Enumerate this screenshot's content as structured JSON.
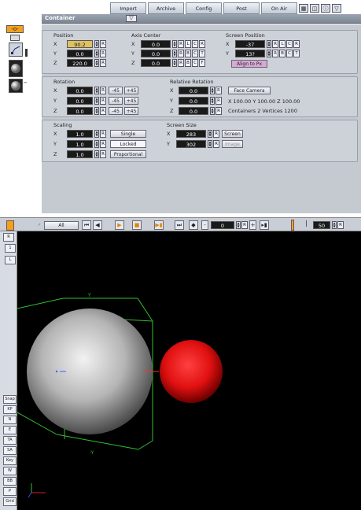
{
  "menu": {
    "items": [
      "Import",
      "Archive",
      "Config",
      "Post",
      "On Air"
    ]
  },
  "panel": {
    "title": "Container"
  },
  "position": {
    "title": "Position",
    "axes": [
      "X",
      "Y",
      "Z"
    ],
    "values": [
      "90.2",
      "0.0",
      "220.0"
    ],
    "reset": "R"
  },
  "axis_center": {
    "title": "Axis Center",
    "axes": [
      "X",
      "Y",
      "Z"
    ],
    "values": [
      "0.0",
      "0.0",
      "0.0"
    ],
    "reset": "R",
    "rows": [
      [
        "L",
        "C",
        "R"
      ],
      [
        "B",
        "C",
        "T"
      ],
      [
        "B",
        "C",
        "F"
      ]
    ]
  },
  "screen_position": {
    "title": "Screen Position",
    "axes": [
      "X",
      "Y"
    ],
    "values": [
      "-37",
      "13?"
    ],
    "reset": "R",
    "rows": [
      [
        "L",
        "C",
        "R"
      ],
      [
        "B",
        "C",
        "T"
      ]
    ],
    "align_label": "Align to Px"
  },
  "rotation": {
    "title": "Rotation",
    "axes": [
      "X",
      "Y",
      "Z"
    ],
    "values": [
      "0.0",
      "0.0",
      "0.0"
    ],
    "reset": "R",
    "minus": "-45",
    "plus": "+45"
  },
  "relative_rotation": {
    "title": "Relative Rotation",
    "axes": [
      "X",
      "Y",
      "Z"
    ],
    "values": [
      "0.0",
      "0.0",
      "0.0"
    ],
    "reset": "R",
    "face_camera": "Face Camera",
    "dims": "X 100.00   Y 100.00   Z 100.00",
    "stats": "Containers 2    Vertices 1200"
  },
  "scaling": {
    "title": "Scaling",
    "axes": [
      "X",
      "Y",
      "Z"
    ],
    "values": [
      "1.0",
      "1.0",
      "1.0"
    ],
    "reset": "R",
    "modes": [
      "Single",
      "Locked",
      "Proportional"
    ]
  },
  "screen_size": {
    "title": "Screen Size",
    "axes": [
      "X",
      "Y"
    ],
    "values": [
      "283",
      "302"
    ],
    "reset": "R",
    "screen_label": "Screen",
    "image_label": "Image"
  },
  "timeline": {
    "all_label": "All",
    "frame_value": "0",
    "end_value": "50",
    "minus": "-",
    "plus": "+",
    "reset": "R"
  },
  "left_tabs": [
    "R",
    "1",
    "L"
  ],
  "bottom_tabs": [
    "Snap",
    "KP",
    "N",
    "E",
    "TA",
    "SA",
    "Key",
    "W",
    "BB",
    "P",
    "Grid"
  ],
  "viewport": {
    "axis_y": "Y",
    "axis_y_bottom": "-Y"
  },
  "colors": {
    "panel": "#c5c9d0",
    "field": "#1a1a1a",
    "highlight": "#e0c060",
    "align_button": "#d9a8d4",
    "bbox": "#2fbf2f",
    "red_sphere": "#ff2020"
  }
}
